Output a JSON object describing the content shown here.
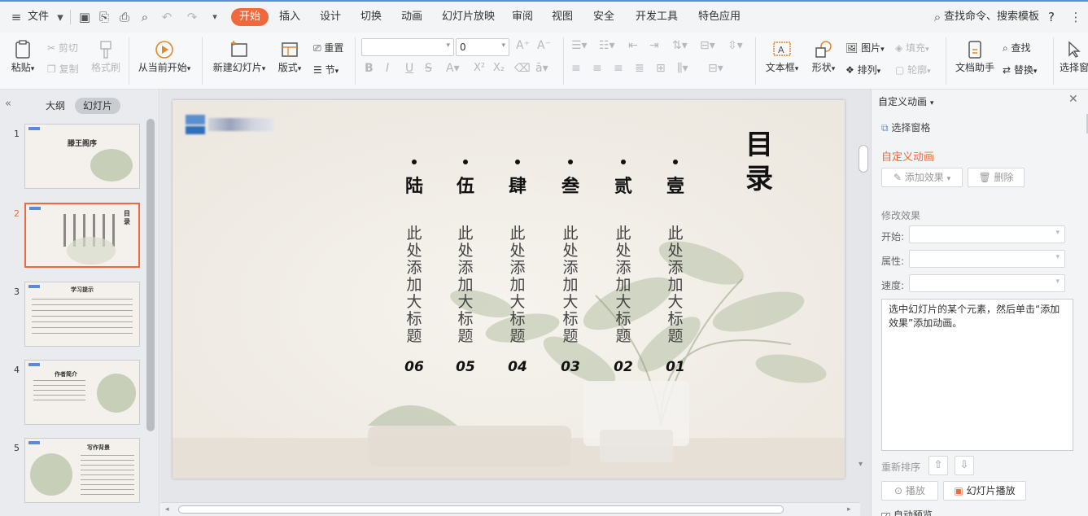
{
  "menubar": {
    "file": "文件",
    "tabs": [
      "开始",
      "插入",
      "设计",
      "切换",
      "动画",
      "幻灯片放映",
      "审阅",
      "视图",
      "安全",
      "开发工具",
      "特色应用"
    ],
    "search": "查找命令、搜索模板",
    "help": "?"
  },
  "ribbon": {
    "paste": "粘贴",
    "cut": "剪切",
    "copy": "复制",
    "format_painter": "格式刷",
    "from_current": "从当前开始",
    "new_slide": "新建幻灯片",
    "layout": "版式",
    "reset": "重置",
    "section": "节",
    "font_size": "0",
    "textbox": "文本框",
    "shape": "形状",
    "picture": "图片",
    "fill": "填充",
    "arrange": "排列",
    "outline": "轮廓",
    "doc_assistant": "文档助手",
    "find": "查找",
    "replace": "替换",
    "select_pane": "选择窗"
  },
  "leftpanel": {
    "tab_outline": "大纲",
    "tab_slides": "幻灯片",
    "thumbs": [
      {
        "num": "1",
        "title": "滕王阁序"
      },
      {
        "num": "2",
        "title": "目录"
      },
      {
        "num": "3",
        "title": "学习提示"
      },
      {
        "num": "4",
        "title": "作者简介"
      },
      {
        "num": "5",
        "title": "写作背景"
      }
    ]
  },
  "slide": {
    "title_chars": [
      "目",
      "录"
    ],
    "columns": [
      {
        "heading": "陆",
        "body": "此处添加大标题",
        "num": "06"
      },
      {
        "heading": "伍",
        "body": "此处添加大标题",
        "num": "05"
      },
      {
        "heading": "肆",
        "body": "此处添加大标题",
        "num": "04"
      },
      {
        "heading": "叁",
        "body": "此处添加大标题",
        "num": "03"
      },
      {
        "heading": "贰",
        "body": "此处添加大标题",
        "num": "02"
      },
      {
        "heading": "壹",
        "body": "此处添加大标题",
        "num": "01"
      }
    ]
  },
  "rightpanel": {
    "title": "自定义动画",
    "select_pane": "选择窗格",
    "section_title": "自定义动画",
    "add_effect": "添加效果",
    "delete": "删除",
    "modify": "修改效果",
    "start": "开始:",
    "property": "属性:",
    "speed": "速度:",
    "hint": "选中幻灯片的某个元素，然后单击“添加效果”添加动画。",
    "reorder": "重新排序",
    "play": "播放",
    "slideshow": "幻灯片播放",
    "autopreview": "自动预览"
  },
  "colors": {
    "accent": "#f0693c",
    "panel": "#f3f4f6"
  }
}
